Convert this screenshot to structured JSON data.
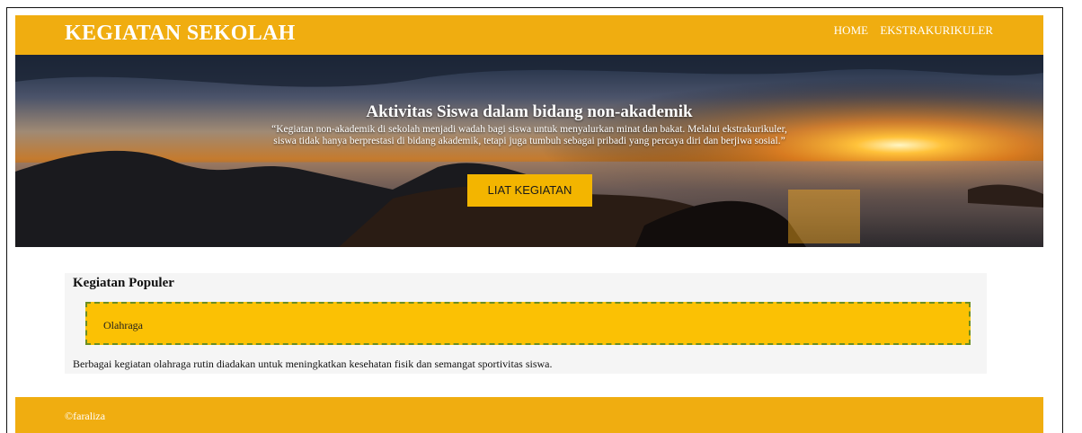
{
  "header": {
    "logo": "KEGIATAN SEKOLAH",
    "nav": [
      "HOME",
      "EKSTRAKURIKULER"
    ]
  },
  "hero": {
    "title": "Aktivitas Siswa dalam bidang non-akademik",
    "text": "“Kegiatan non-akademik di sekolah menjadi wadah bagi siswa untuk menyalurkan minat dan bakat. Melalui ekstrakurikuler, siswa tidak hanya berprestasi di bidang akademik, tetapi juga tumbuh sebagai pribadi yang percaya diri dan berjiwa sosial.”",
    "button": "LIAT KEGIATAN"
  },
  "popular": {
    "title": "Kegiatan Populer",
    "card_label": "Olahraga",
    "description": "Berbagai kegiatan olahraga rutin diadakan untuk meningkatkan kesehatan fisik dan semangat sportivitas siswa."
  },
  "footer": {
    "text": "©faraliza"
  },
  "colors": {
    "header_bg": "#f0ad10",
    "button_bg": "#f3b500",
    "card_bg": "#fbc104",
    "card_border": "#6b8e23"
  }
}
